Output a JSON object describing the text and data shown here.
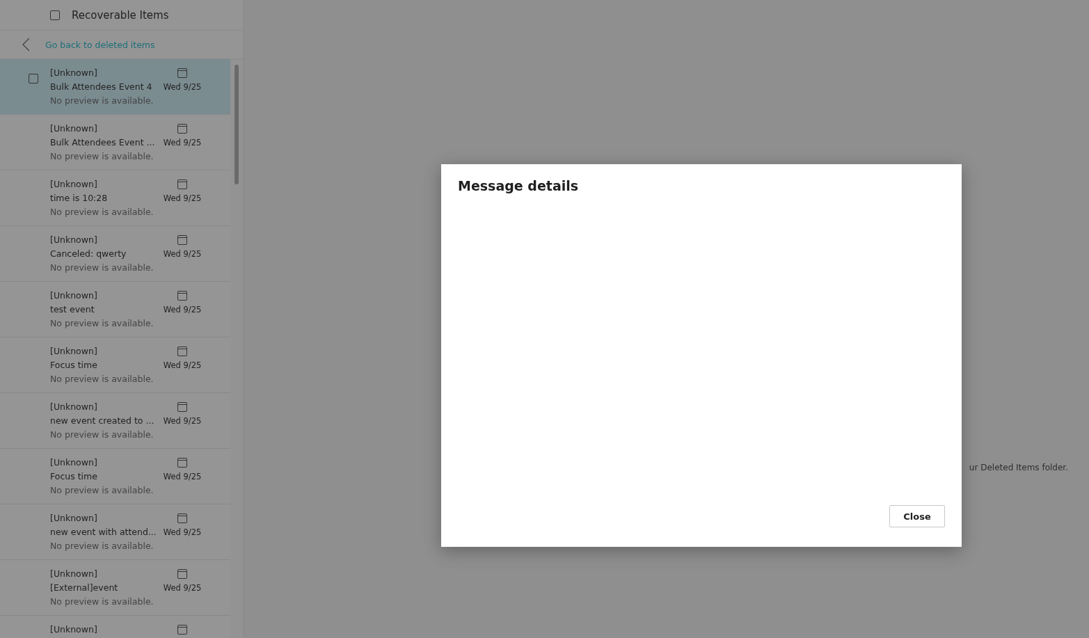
{
  "header": {
    "title": "Recoverable Items",
    "checked": false
  },
  "back_link": "Go back to deleted items",
  "messages": [
    {
      "sender": "[Unknown]",
      "subject": "Bulk Attendees Event 4",
      "date": "Wed 9/25",
      "preview": "No preview is available.",
      "selected": true
    },
    {
      "sender": "[Unknown]",
      "subject": "Bulk Attendees Event ...",
      "date": "Wed 9/25",
      "preview": "No preview is available.",
      "selected": false
    },
    {
      "sender": "[Unknown]",
      "subject": "time is 10:28",
      "date": "Wed 9/25",
      "preview": "No preview is available.",
      "selected": false
    },
    {
      "sender": "[Unknown]",
      "subject": "Canceled: qwerty",
      "date": "Wed 9/25",
      "preview": "No preview is available.",
      "selected": false
    },
    {
      "sender": "[Unknown]",
      "subject": "test event",
      "date": "Wed 9/25",
      "preview": "No preview is available.",
      "selected": false
    },
    {
      "sender": "[Unknown]",
      "subject": "Focus time",
      "date": "Wed 9/25",
      "preview": "No preview is available.",
      "selected": false
    },
    {
      "sender": "[Unknown]",
      "subject": "new event created to ...",
      "date": "Wed 9/25",
      "preview": "No preview is available.",
      "selected": false
    },
    {
      "sender": "[Unknown]",
      "subject": "Focus time",
      "date": "Wed 9/25",
      "preview": "No preview is available.",
      "selected": false
    },
    {
      "sender": "[Unknown]",
      "subject": "new event with attend...",
      "date": "Wed 9/25",
      "preview": "No preview is available.",
      "selected": false
    },
    {
      "sender": "[Unknown]",
      "subject": "[External]event",
      "date": "Wed 9/25",
      "preview": "No preview is available.",
      "selected": false
    },
    {
      "sender": "[Unknown]",
      "selected": false
    }
  ],
  "background_text": "ur Deleted Items folder.",
  "dialog": {
    "title": "Message details",
    "button": "Close"
  }
}
